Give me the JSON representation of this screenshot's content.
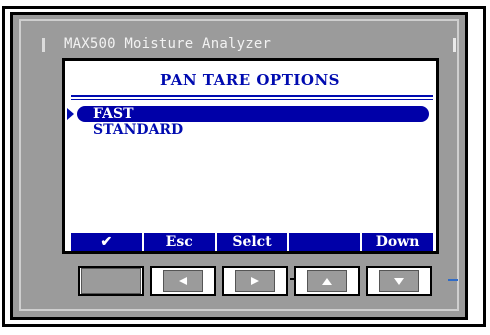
{
  "window": {
    "title": "MAX500 Moisture Analyzer"
  },
  "screen": {
    "heading": "PAN TARE OPTIONS",
    "options": [
      {
        "label": "FAST",
        "selected": true
      },
      {
        "label": "STANDARD",
        "selected": false
      }
    ]
  },
  "softkeys": [
    "✔",
    "Esc",
    "Selct",
    "",
    "Down"
  ],
  "hardware_buttons": [
    {
      "icon": "blank"
    },
    {
      "icon": "left-arrow-icon"
    },
    {
      "icon": "right-arrow-icon"
    },
    {
      "icon": "up-arrow-icon"
    },
    {
      "icon": "down-arrow-icon"
    }
  ],
  "colors": {
    "accent": "#0000a8",
    "bezel": "#9b9b9b"
  }
}
